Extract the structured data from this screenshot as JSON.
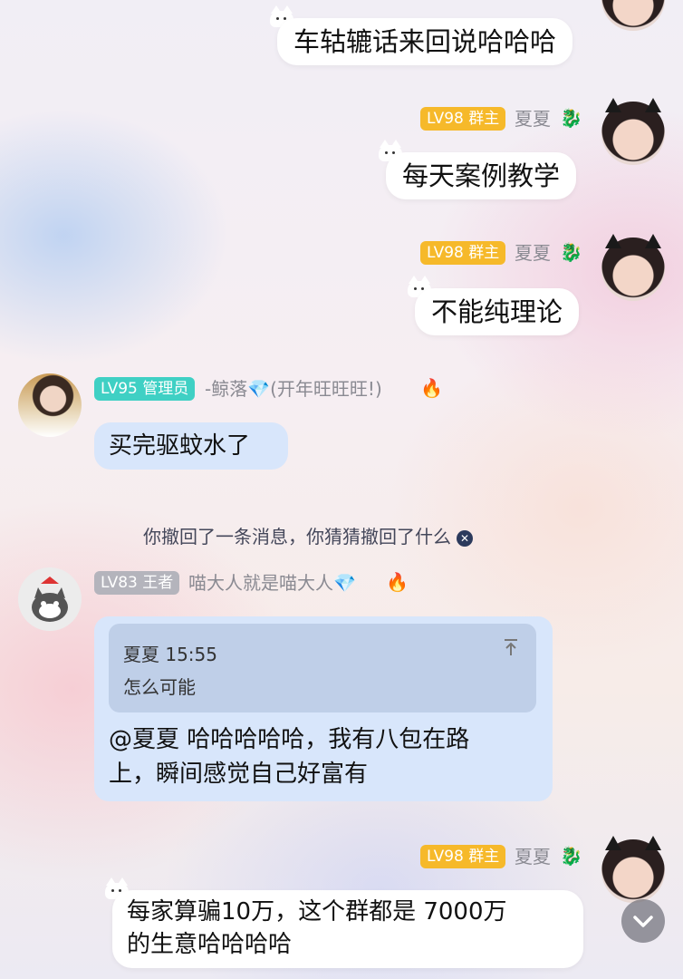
{
  "messages": {
    "m1": {
      "text": "车轱辘话来回说哈哈哈"
    },
    "m2": {
      "level": "LV98 群主",
      "name": "夏夏",
      "text": "每天案例教学"
    },
    "m3": {
      "level": "LV98 群主",
      "name": "夏夏",
      "text": "不能纯理论"
    },
    "m4": {
      "level": "LV95 管理员",
      "name": "-鲸落💎(开年旺旺旺!)",
      "text": "买完驱蚊水了"
    },
    "system": {
      "text": "你撤回了一条消息，你猜猜撤回了什么",
      "close": "✕"
    },
    "m5": {
      "level": "LV83 王者",
      "name": "喵大人就是喵大人💎",
      "quote_author": "夏夏 15:55",
      "quote_text": "怎么可能",
      "line1": "@夏夏 哈哈哈哈哈，我有八包在路",
      "line2": "上，瞬间感觉自己好富有"
    },
    "m6": {
      "level": "LV98 群主",
      "name": "夏夏",
      "line1": "每家算骗10万，这个群都是 7000万",
      "line2": "的生意哈哈哈哈"
    }
  },
  "icons": {
    "fire": "fire-icon",
    "dragon": "dragon-icon",
    "scroll": "chevron-down-icon"
  },
  "colors": {
    "owner_badge": "#f6b92a",
    "admin_badge": "#3fd0c4",
    "king_badge": "#b4b4bc",
    "reply_bubble": "#d8e6fb"
  }
}
